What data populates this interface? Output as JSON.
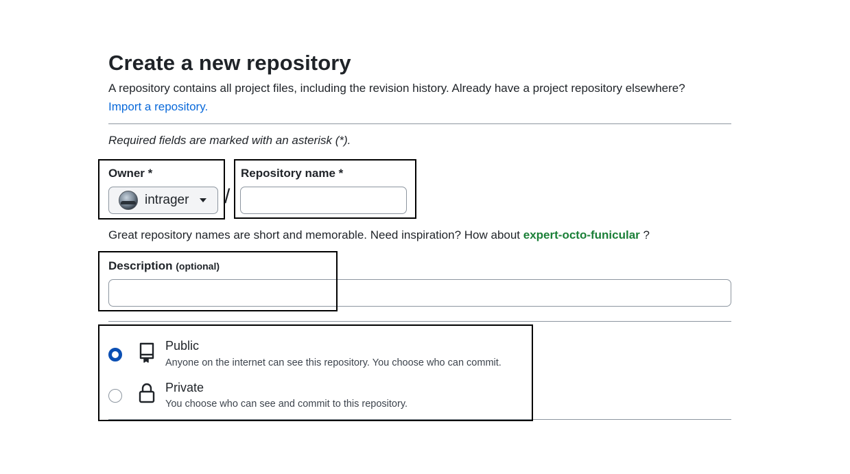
{
  "page": {
    "title": "Create a new repository",
    "intro": "A repository contains all project files, including the revision history. Already have a project repository elsewhere?",
    "import_link": "Import a repository.",
    "required_note": "Required fields are marked with an asterisk (*)."
  },
  "owner": {
    "label": "Owner *",
    "value": "intrager"
  },
  "separator": "/",
  "repo_name": {
    "label": "Repository name *",
    "value": "",
    "placeholder": ""
  },
  "name_hint": {
    "prefix": "Great repository names are short and memorable. Need inspiration? How about",
    "suggestion": "expert-octo-funicular",
    "suffix": "?"
  },
  "description": {
    "label": "Description",
    "optional": "(optional)",
    "value": "",
    "placeholder": ""
  },
  "visibility": {
    "selected": "public",
    "options": [
      {
        "id": "public",
        "title": "Public",
        "description": "Anyone on the internet can see this repository. You choose who can commit.",
        "icon": "repo-icon"
      },
      {
        "id": "private",
        "title": "Private",
        "description": "You choose who can see and commit to this repository.",
        "icon": "lock-icon"
      }
    ]
  },
  "colors": {
    "link": "#0969da",
    "suggestion": "#1a7f37",
    "radio_selected": "#0b4fb3",
    "annotation_box": "#000000"
  }
}
